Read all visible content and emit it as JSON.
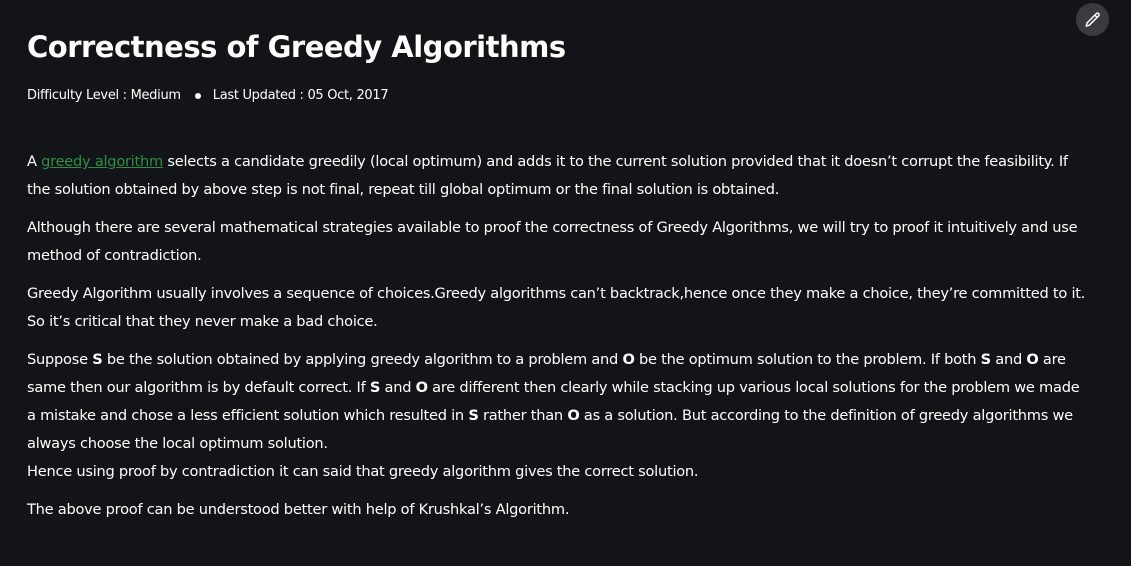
{
  "article": {
    "title": "Correctness of Greedy Algorithms",
    "difficulty": "Difficulty Level : Medium",
    "updated": "Last Updated : 05 Oct, 2017",
    "p1": {
      "a": "A ",
      "link": "greedy algorithm",
      "rest": " selects a candidate greedily (local optimum) and adds it to the current solution provided that it doesn’t corrupt the feasibility. If the solution obtained by above step is not final, repeat till global optimum or the final solution is obtained."
    },
    "p2": "Although there are several mathematical strategies available to proof the correctness of Greedy Algorithms, we will try to proof it intuitively and use method of contradiction.",
    "p3": "Greedy Algorithm usually involves a sequence of choices.Greedy algorithms can’t backtrack,hence once they make a choice, they’re committed to it. So it’s critical that they never make a bad choice.",
    "p4": {
      "t1": "Suppose ",
      "S": "S",
      "t2": " be the solution obtained by applying greedy algorithm to a problem and ",
      "O": "O",
      "t3": " be the optimum solution to the problem. If both ",
      "t4": " and ",
      "t5": " are same then our algorithm is by default correct. If ",
      "t6": " and ",
      "t7": " are different then clearly while stacking up various local solutions for the problem we made a mistake and chose a less efficient solution which resulted in ",
      "t8": " rather than ",
      "t9": " as a solution. But according to the definition of greedy algorithms we always choose the local optimum solution.",
      "t10": "Hence using proof by contradiction it can said that greedy algorithm gives the correct solution."
    },
    "p5": "The above proof can be understood better with help of Krushkal’s Algorithm."
  },
  "toolbar": {
    "edit_icon": "pencil-icon"
  }
}
